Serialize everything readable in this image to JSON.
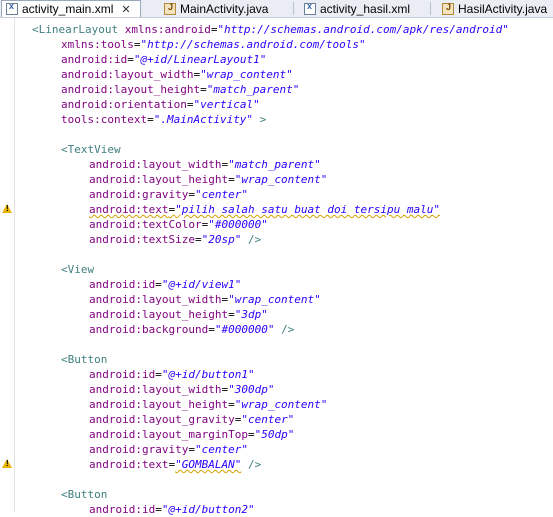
{
  "tabs": [
    {
      "label": "activity_main.xml",
      "icon": "xml-file-icon",
      "active": true
    },
    {
      "label": "MainActivity.java",
      "icon": "java-file-icon",
      "active": false
    },
    {
      "label": "activity_hasil.xml",
      "icon": "xml-file-icon",
      "active": false
    },
    {
      "label": "HasilActivity.java",
      "icon": "java-file-icon",
      "active": false
    }
  ],
  "close_symbol": "✕",
  "code": {
    "l1": {
      "tag": "<LinearLayout",
      "a1": "xmlns:android",
      "v1": "\"http://schemas.android.com/apk/res/android\""
    },
    "l2": {
      "a": "xmlns:tools",
      "v": "\"http://schemas.android.com/tools\""
    },
    "l3": {
      "a": "android:id",
      "v": "\"@+id/LinearLayout1\""
    },
    "l4": {
      "a": "android:layout_width",
      "v": "\"wrap_content\""
    },
    "l5": {
      "a": "android:layout_height",
      "v": "\"match_parent\""
    },
    "l6": {
      "a": "android:orientation",
      "v": "\"vertical\""
    },
    "l7": {
      "a": "tools:context",
      "v": "\".MainActivity\"",
      "end": " >"
    },
    "l9": {
      "tag": "<TextView"
    },
    "l10": {
      "a": "android:layout_width",
      "v": "\"match_parent\""
    },
    "l11": {
      "a": "android:layout_height",
      "v": "\"wrap_content\""
    },
    "l12": {
      "a": "android:gravity",
      "v": "\"center\""
    },
    "l13": {
      "a": "android:text",
      "v": "\"pilih salah satu buat doi tersipu malu\""
    },
    "l14": {
      "a": "android:textColor",
      "v": "\"#000000\""
    },
    "l15": {
      "a": "android:textSize",
      "v": "\"20sp\"",
      "end": " />"
    },
    "l17": {
      "tag": "<View"
    },
    "l18": {
      "a": "android:id",
      "v": "\"@+id/view1\""
    },
    "l19": {
      "a": "android:layout_width",
      "v": "\"wrap_content\""
    },
    "l20": {
      "a": "android:layout_height",
      "v": "\"3dp\""
    },
    "l21": {
      "a": "android:background",
      "v": "\"#000000\"",
      "end": " />"
    },
    "l23": {
      "tag": "<Button"
    },
    "l24": {
      "a": "android:id",
      "v": "\"@+id/button1\""
    },
    "l25": {
      "a": "android:layout_width",
      "v": "\"300dp\""
    },
    "l26": {
      "a": "android:layout_height",
      "v": "\"wrap_content\""
    },
    "l27": {
      "a": "android:layout_gravity",
      "v": "\"center\""
    },
    "l28": {
      "a": "android:layout_marginTop",
      "v": "\"50dp\""
    },
    "l29": {
      "a": "android:gravity",
      "v": "\"center\""
    },
    "l30": {
      "a": "android:text",
      "v": "\"GOMBALAN\"",
      "end": " />"
    },
    "l32": {
      "tag": "<Button"
    },
    "l33": {
      "a": "android:id",
      "v": "\"@+id/button2\""
    }
  }
}
